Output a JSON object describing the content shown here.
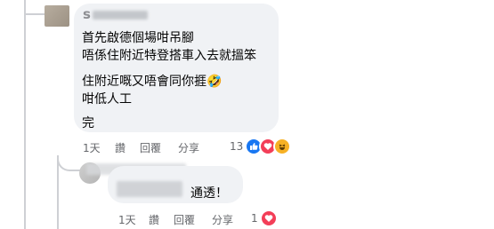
{
  "comment": {
    "author_initial": "s",
    "lines": [
      "首先啟德個場咁吊腳",
      "唔係住附近特登搭車入去就搵笨",
      "住附近嘅又唔會同你捱🤣",
      "咁低人工",
      "完"
    ],
    "time": "1天",
    "actions": [
      "讚",
      "回覆",
      "分享"
    ],
    "reaction_count": "13",
    "reactions": [
      "like-icon",
      "love-icon",
      "haha-icon"
    ]
  },
  "reply": {
    "text": "通透！",
    "time": "1天",
    "actions": [
      "讚",
      "回覆",
      "分享"
    ],
    "reaction_count": "1",
    "reactions": [
      "love-icon"
    ]
  },
  "colors": {
    "bubble": "#f0f2f5",
    "like": "#1877f2",
    "love": "#f33e58",
    "haha": "#f7b125",
    "meta": "#65676b"
  }
}
